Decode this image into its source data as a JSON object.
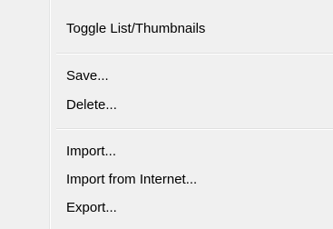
{
  "menu": {
    "items": [
      {
        "label": "Toggle List/Thumbnails"
      },
      {
        "label": "Save..."
      },
      {
        "label": "Delete..."
      },
      {
        "label": "Import..."
      },
      {
        "label": "Import from Internet..."
      },
      {
        "label": "Export..."
      }
    ]
  },
  "colors": {
    "menu_background": "#f0f0f0",
    "separator": "#e0e0e0",
    "text": "#000000"
  }
}
